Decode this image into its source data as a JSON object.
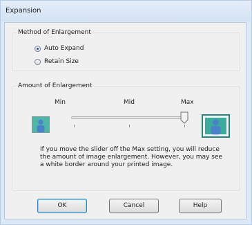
{
  "window": {
    "title": "Expansion"
  },
  "method_group": {
    "title": "Method of Enlargement",
    "options": [
      {
        "label": "Auto Expand",
        "checked": true
      },
      {
        "label": "Retain Size",
        "checked": false
      }
    ]
  },
  "amount_group": {
    "title": "Amount of Enlargement",
    "slider": {
      "min_label": "Min",
      "mid_label": "Mid",
      "max_label": "Max",
      "value": "Max"
    },
    "description": "If you move the slider off the Max setting, you will reduce the amount of image enlargement. However, you may see a white border around your printed image."
  },
  "buttons": {
    "ok": "OK",
    "cancel": "Cancel",
    "help": "Help"
  },
  "colors": {
    "title_bar": "#dce8f6",
    "preview_teal": "#4fb6aa",
    "person_blue": "#4a82c8"
  },
  "icons": {
    "small_preview": "person-small-icon",
    "large_preview": "person-large-icon",
    "slider_thumb": "slider-thumb-icon"
  }
}
